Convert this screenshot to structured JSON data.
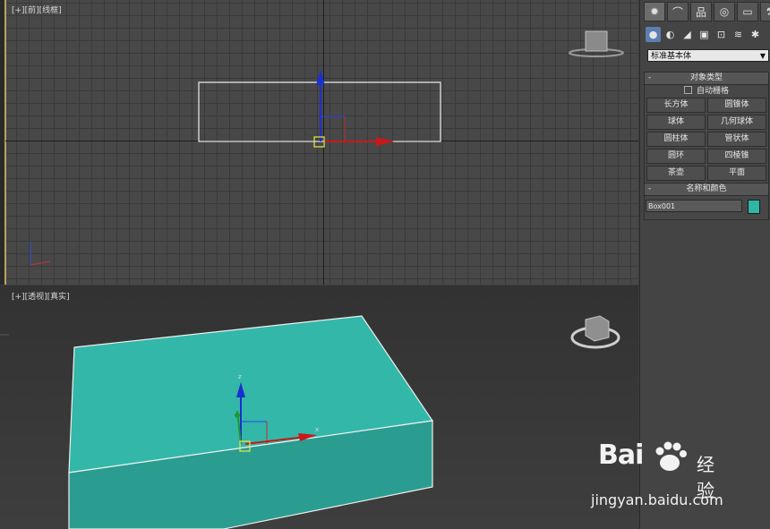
{
  "viewports": {
    "front": {
      "label": "[+][前][线框]"
    },
    "perspective": {
      "label": "[+][透视][真实]"
    }
  },
  "command_panel": {
    "tabs": [
      {
        "icon": "create-icon",
        "glyph": "✹"
      },
      {
        "icon": "modify-icon",
        "glyph": "⌒"
      },
      {
        "icon": "hierarchy-icon",
        "glyph": "品"
      },
      {
        "icon": "motion-icon",
        "glyph": "◎"
      },
      {
        "icon": "display-icon",
        "glyph": "▭"
      },
      {
        "icon": "utilities-icon",
        "glyph": "⚒"
      }
    ],
    "subcategories": [
      {
        "icon": "geometry-icon",
        "glyph": "●"
      },
      {
        "icon": "shapes-icon",
        "glyph": "◐"
      },
      {
        "icon": "lights-icon",
        "glyph": "◢"
      },
      {
        "icon": "cameras-icon",
        "glyph": "▣"
      },
      {
        "icon": "helpers-icon",
        "glyph": "⊡"
      },
      {
        "icon": "spacewarps-icon",
        "glyph": "≋"
      },
      {
        "icon": "systems-icon",
        "glyph": "✱"
      }
    ],
    "category_dropdown": "标准基本体",
    "object_type": {
      "title": "对象类型",
      "auto_grid": "自动栅格",
      "buttons": [
        "长方体",
        "圆锥体",
        "球体",
        "几何球体",
        "圆柱体",
        "管状体",
        "圆环",
        "四棱锥",
        "茶壶",
        "平面"
      ]
    },
    "name_color": {
      "title": "名称和颜色",
      "name": "Box001",
      "color": "#2fb5a6"
    }
  },
  "gizmo": {
    "x_label": "x",
    "z_label": "z"
  },
  "watermark": {
    "brand": "Bai",
    "brand_suffix": "经验",
    "url": "jingyan.baidu.com"
  }
}
